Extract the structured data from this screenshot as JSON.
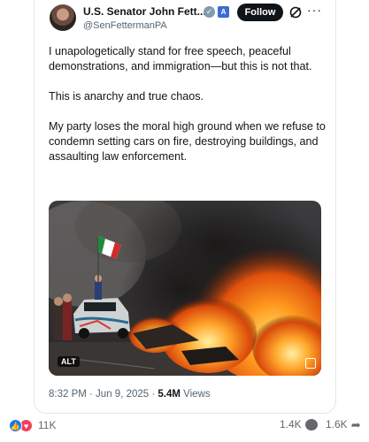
{
  "post": {
    "author_name": "U.S. Senator John Fett...",
    "handle": "@SenFettermanPA",
    "verified_badge": "✓",
    "gov_badge": "A",
    "follow_label": "Follow",
    "more_label": "···",
    "paragraphs": [
      "I unapologetically stand for free speech, peaceful demonstrations, and immigration—but this is not that.",
      "This is anarchy and true chaos.",
      "My party loses the moral high ground when we refuse to condemn setting cars on fire, destroying buildings, and assaulting law enforcement."
    ],
    "media": {
      "alt_label": "ALT"
    },
    "time": "8:32 PM · Jun 9, 2025 · ",
    "views_count": "5.4M",
    "views_label": " Views"
  },
  "footer": {
    "reaction_count": "11K",
    "comments_count": "1.4K",
    "shares_count": "1.6K",
    "like_glyph": "👍",
    "love_glyph": "♥",
    "share_glyph": "➦"
  },
  "colors": {
    "like_blue": "#1877f2",
    "love_red": "#f33e58",
    "follow_bg": "#0f1419",
    "secondary_text": "#536471"
  },
  "icons": {
    "verified": "verified-check-icon",
    "government": "government-badge-icon",
    "grok": "grok-icon",
    "more": "more-icon",
    "comment": "comment-bubble-icon",
    "share": "share-arrow-icon"
  }
}
